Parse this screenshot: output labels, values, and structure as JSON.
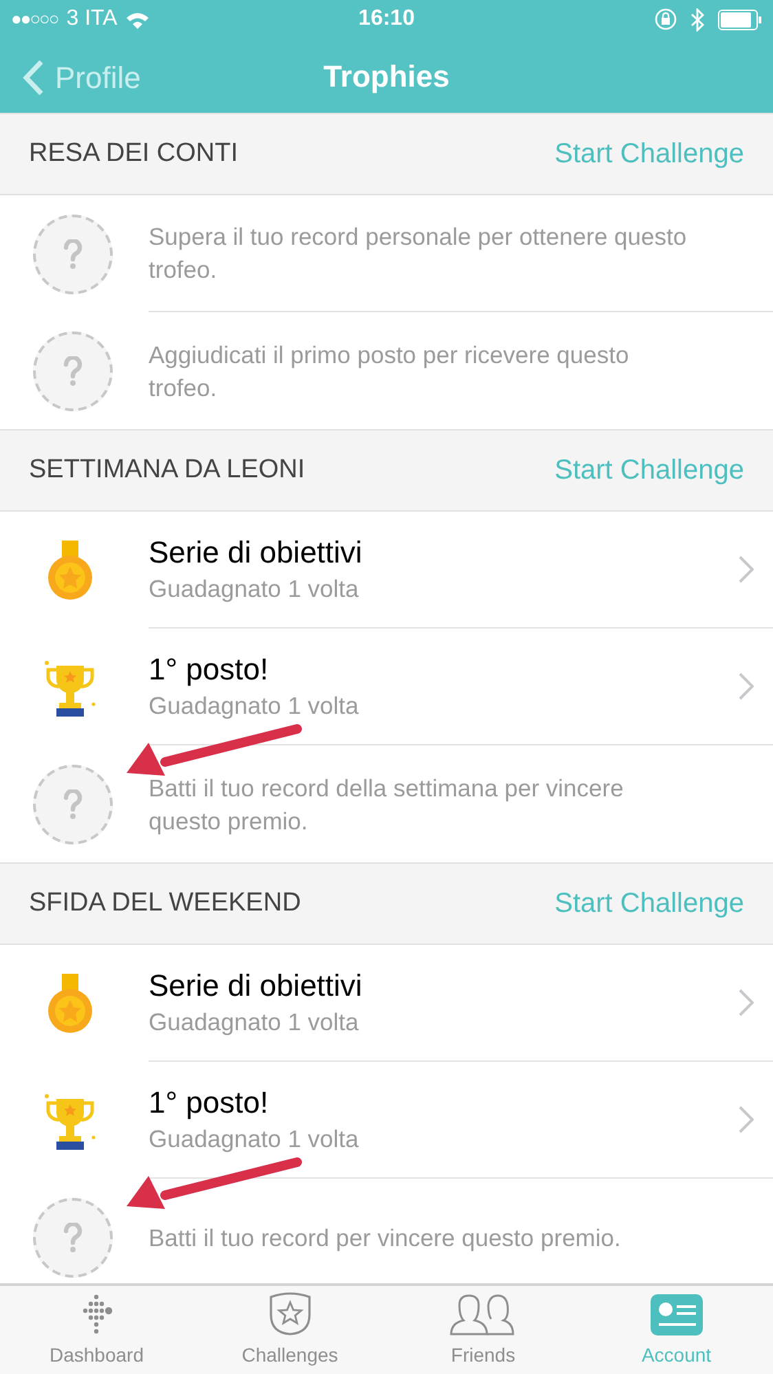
{
  "status_bar": {
    "carrier": "3 ITA",
    "time": "16:10",
    "signal": "●●○○○"
  },
  "nav": {
    "back": "Profile",
    "title": "Trophies"
  },
  "sections": [
    {
      "title": "RESA DEI CONTI",
      "action": "Start Challenge",
      "items": [
        {
          "kind": "locked",
          "text": "Supera il tuo record personale per ottenere questo trofeo.",
          "arrow": false
        },
        {
          "kind": "locked",
          "text": "Aggiudicati il primo posto per ricevere questo trofeo.",
          "arrow": false
        }
      ]
    },
    {
      "title": "SETTIMANA DA LEONI",
      "action": "Start Challenge",
      "items": [
        {
          "kind": "medal",
          "title": "Serie di obiettivi",
          "subtitle": "Guadagnato 1 volta"
        },
        {
          "kind": "cup",
          "title": "1° posto!",
          "subtitle": "Guadagnato 1 volta"
        },
        {
          "kind": "locked",
          "text": "Batti il tuo record della settimana per vincere questo premio.",
          "arrow": true
        }
      ]
    },
    {
      "title": "SFIDA DEL WEEKEND",
      "action": "Start Challenge",
      "items": [
        {
          "kind": "medal",
          "title": "Serie di obiettivi",
          "subtitle": "Guadagnato 1 volta"
        },
        {
          "kind": "cup",
          "title": "1° posto!",
          "subtitle": "Guadagnato 1 volta"
        },
        {
          "kind": "locked",
          "text": "Batti il tuo record per vincere questo premio.",
          "arrow": true
        }
      ]
    }
  ],
  "tabs": [
    {
      "kind": "dashboard",
      "label": "Dashboard",
      "selected": false
    },
    {
      "kind": "challenges",
      "label": "Challenges",
      "selected": false
    },
    {
      "kind": "friends",
      "label": "Friends",
      "selected": false
    },
    {
      "kind": "account",
      "label": "Account",
      "selected": true
    }
  ]
}
